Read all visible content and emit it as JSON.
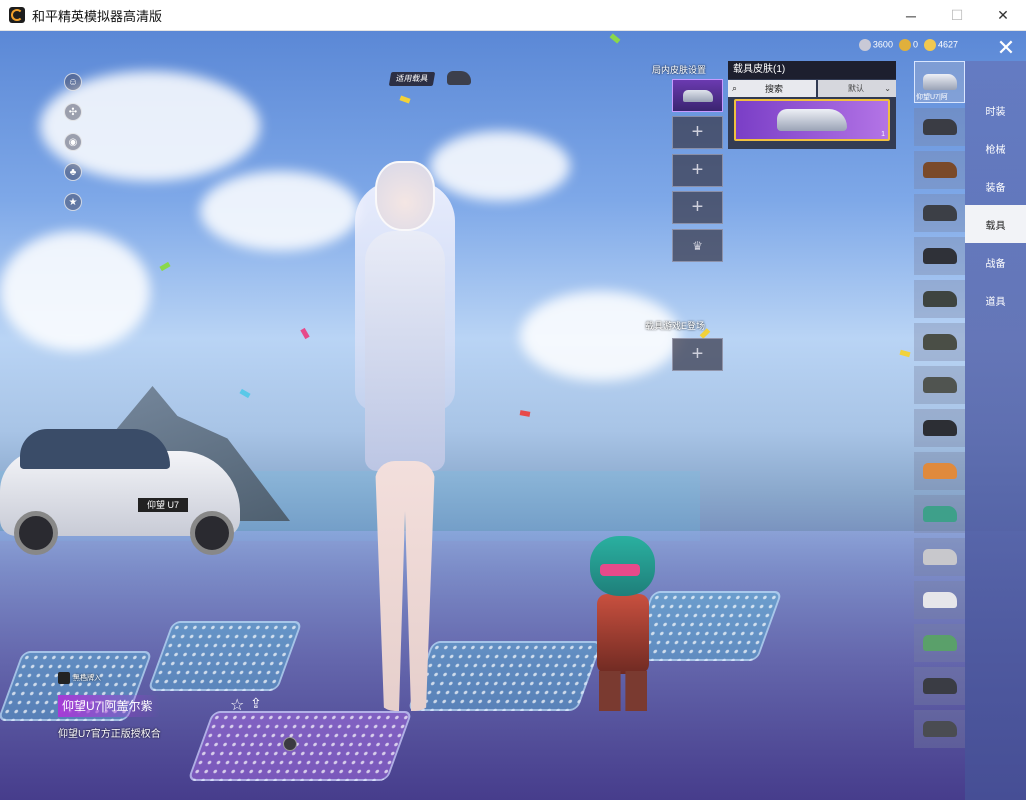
{
  "window": {
    "title": "和平精英模拟器高清版",
    "minimize": "─",
    "maximize": "☐",
    "close": "✕"
  },
  "hud": {
    "apply_vehicle_tag": "适用载具",
    "currency": [
      {
        "icon": "coin-icon",
        "value": "3600",
        "color": "#c9c9d6"
      },
      {
        "icon": "token-icon",
        "value": "0",
        "color": "#e0b03c"
      },
      {
        "icon": "diamond-icon",
        "value": "4627",
        "color": "#f0c850"
      }
    ],
    "close_button": "✕"
  },
  "ingame_skin": {
    "label": "局内皮肤设置",
    "slot_plus": "+",
    "secondary_label": "载具游戏E登场"
  },
  "skin_panel": {
    "title": "载具皮肤(1)",
    "search_label": "搜索",
    "sort_label": "默认",
    "card_count": "1"
  },
  "vehicle_list": {
    "selected_label": "仰望U7|阿",
    "selected_count": "1",
    "items": [
      {
        "icon": "motorcycle-icon",
        "color": "#3a3c44"
      },
      {
        "icon": "horse-icon",
        "color": "#7a4a2a"
      },
      {
        "icon": "buggy-icon",
        "color": "#3c3f46"
      },
      {
        "icon": "motorcycle-sidecar-icon",
        "color": "#2f3138"
      },
      {
        "icon": "jeep-icon",
        "color": "#3e4440"
      },
      {
        "icon": "jeep-icon",
        "color": "#4a4e46"
      },
      {
        "icon": "jeep-icon",
        "color": "#505450"
      },
      {
        "icon": "monster-truck-icon",
        "color": "#2c2e34"
      },
      {
        "icon": "sports-car-icon",
        "color": "#e08a3c"
      },
      {
        "icon": "sedan-icon",
        "color": "#3ea08a"
      },
      {
        "icon": "sedan-icon",
        "color": "#c8c8cc"
      },
      {
        "icon": "coupe-icon",
        "color": "#e6e6ea"
      },
      {
        "icon": "van-icon",
        "color": "#5aa06a"
      },
      {
        "icon": "pickup-icon",
        "color": "#3a3c44"
      },
      {
        "icon": "suv-icon",
        "color": "#4a4c52"
      }
    ]
  },
  "categories": [
    {
      "label": "时装",
      "active": false
    },
    {
      "label": "枪械",
      "active": false
    },
    {
      "label": "装备",
      "active": false
    },
    {
      "label": "载具",
      "active": true
    },
    {
      "label": "战备",
      "active": false
    },
    {
      "label": "道具",
      "active": false
    }
  ],
  "vehicle_info": {
    "owner_label": "黑档牌入",
    "name": "仰望U7|阿盖尔紫",
    "description": "仰望U7官方正版授权合",
    "plate": "仰望 U7",
    "star": "☆",
    "share": "⇪"
  }
}
